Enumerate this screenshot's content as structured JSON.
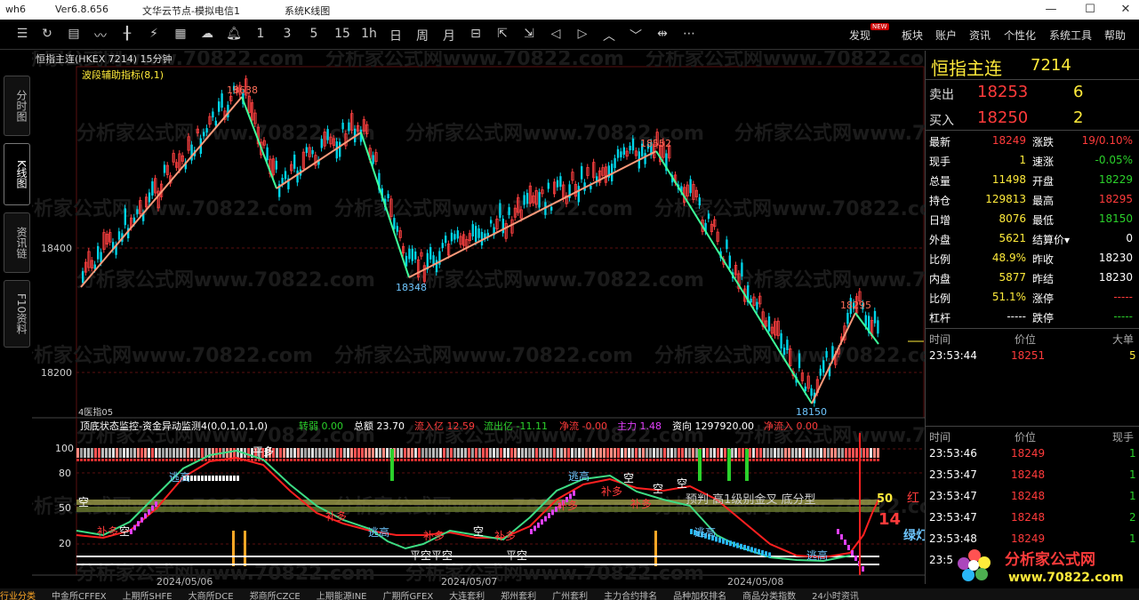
{
  "titlebar": {
    "app": "wh6",
    "version": "Ver6.8.656",
    "server": "文华云节点-模拟电信1",
    "window": "系统K线图",
    "min": "—",
    "max": "☐",
    "close": "✕"
  },
  "toolbar": {
    "periods": [
      "1",
      "3",
      "5",
      "15",
      "1h",
      "日",
      "周",
      "月"
    ],
    "menus": [
      "发现",
      "板块",
      "账户",
      "资讯",
      "个性化",
      "系统工具",
      "帮助"
    ],
    "new_badge": "NEW"
  },
  "lefttabs": [
    "分时图",
    "K线图",
    "资讯链",
    "F10资料"
  ],
  "chart": {
    "header": "恒指主连(HKEX 7214)  15分钟",
    "indicator_name": "波段辅助指标(8,1)",
    "price_labels": [
      "18400",
      "18200"
    ],
    "wave_labels": [
      "18638",
      "18348",
      "18552",
      "18295",
      "18150"
    ],
    "sub_label": "4医指05",
    "watermark": "分析家公式网www.70822.com",
    "sub": {
      "title": "顶底状态监控-资金异动监测4(0,0,1,0,1,0)",
      "zr": "转弱 0.00",
      "zj": "总额 23.70",
      "lr": "流入亿 12.59",
      "lc": "流出亿 -11.11",
      "jl": "净流 -0.00",
      "zl": "主力 1.48",
      "zx": "资向 1297920.00",
      "jlr": "净流入 0.00",
      "axis": [
        "100",
        "80",
        "50",
        "20"
      ],
      "labels_red": [
        "补多",
        "补多",
        "补多",
        "补多",
        "补多",
        "补多",
        "补多"
      ],
      "labels_blue": [
        "逃高",
        "逃高",
        "逃高",
        "逃高",
        "逃高"
      ],
      "labels_green": [
        "空",
        "空",
        "空",
        "空",
        "空",
        "空"
      ],
      "labels_white": [
        "平空平空",
        "平空",
        "平多"
      ],
      "label_center": "预判 高1级别金叉 底分型",
      "num50": "50",
      "red_word": "红",
      "num14": "14",
      "green_word": "绿灯"
    },
    "dates": [
      "2024/05/06",
      "2024/05/07",
      "2024/05/08"
    ]
  },
  "panel": {
    "name": "恒指主连",
    "code": "7214",
    "sell_label": "卖出",
    "sell_price": "18253",
    "sell_vol": "6",
    "buy_label": "买入",
    "buy_price": "18250",
    "buy_vol": "2",
    "rows": [
      [
        "最新",
        "18249",
        "涨跌",
        "19/0.10%"
      ],
      [
        "现手",
        "1",
        "速涨",
        "-0.05%"
      ],
      [
        "总量",
        "11498",
        "开盘",
        "18229"
      ],
      [
        "持仓",
        "129813",
        "最高",
        "18295"
      ],
      [
        "日增",
        "8076",
        "最低",
        "18150"
      ],
      [
        "外盘",
        "5621",
        "结算价▾",
        "0"
      ],
      [
        "比例",
        "48.9%",
        "昨收",
        "18230"
      ],
      [
        "内盘",
        "5877",
        "昨结",
        "18230"
      ],
      [
        "比例",
        "51.1%",
        "涨停",
        "-----"
      ],
      [
        "杠杆",
        "-----",
        "跌停",
        "-----"
      ]
    ],
    "big_hdr": [
      "时间",
      "价位",
      "大单"
    ],
    "big_row": [
      "23:53:44",
      "18251",
      "5"
    ],
    "trade_hdr": [
      "时间",
      "价位",
      "现手"
    ],
    "trades": [
      [
        "23:53:46",
        "18249",
        "1"
      ],
      [
        "23:53:47",
        "18248",
        "1"
      ],
      [
        "23:53:47",
        "18248",
        "1"
      ],
      [
        "23:53:47",
        "18248",
        "2"
      ],
      [
        "23:53:48",
        "18249",
        "1"
      ],
      [
        "23:5",
        "",
        ""
      ]
    ]
  },
  "logo": {
    "text": "分析家公式网",
    "url": "www.70822.com"
  },
  "bottombar": [
    "行业分类",
    "中金所CFFEX",
    "上期所SHFE",
    "大商所DCE",
    "郑商所CZCE",
    "上期能源INE",
    "广期所GFEX",
    "大连套利",
    "郑州套利",
    "广州套利",
    "主力合约排名",
    "品种加权排名",
    "商品分类指数",
    "24小时资讯"
  ]
}
